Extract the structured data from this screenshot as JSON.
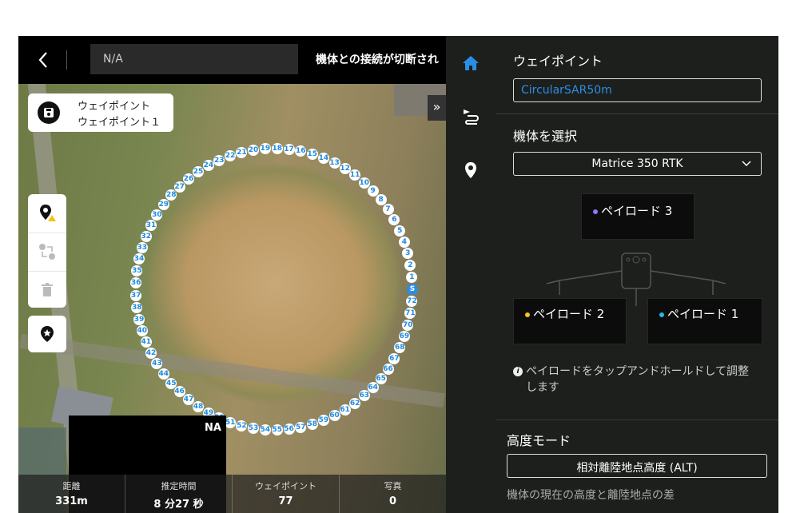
{
  "topbar": {
    "name_value": "N/A",
    "status": "機体との接続が切断され"
  },
  "save_card": {
    "line1": "ウェイポイント",
    "line2": "ウェイポイント１"
  },
  "waypoints": {
    "count": 77,
    "start_label": "S",
    "labels": [
      "1",
      "2",
      "3",
      "4",
      "5",
      "6",
      "7",
      "8",
      "9",
      "10",
      "11",
      "12",
      "13",
      "14",
      "15",
      "16",
      "17",
      "18",
      "19",
      "20",
      "21",
      "22",
      "23",
      "24",
      "25",
      "26",
      "27",
      "28",
      "29",
      "30",
      "31",
      "32",
      "33",
      "34",
      "35",
      "36",
      "37",
      "38",
      "39",
      "40",
      "41",
      "42",
      "43",
      "44",
      "45",
      "46",
      "47",
      "48",
      "49",
      "50",
      "51",
      "52",
      "53",
      "54",
      "55",
      "56",
      "57",
      "58",
      "59",
      "60",
      "61",
      "62",
      "63",
      "64",
      "65",
      "66",
      "67",
      "68",
      "69",
      "70",
      "71",
      "72"
    ],
    "accent": "#1e8be0"
  },
  "na_box": {
    "label": "NA"
  },
  "stats": [
    {
      "label": "距離",
      "value": "331m"
    },
    {
      "label": "推定時間",
      "value": "8 分27 秒"
    },
    {
      "label": "ウェイポイント",
      "value": "77"
    },
    {
      "label": "写真",
      "value": "0"
    }
  ],
  "nav": {
    "items": [
      {
        "icon": "home-icon",
        "active": true
      },
      {
        "icon": "route-icon",
        "active": false
      },
      {
        "icon": "location-pin-icon",
        "active": false
      }
    ],
    "active_color": "#2a8ee8"
  },
  "panel": {
    "waypoint_title": "ウェイポイント",
    "mission_name": "CircularSAR50m",
    "aircraft_title": "機体を選択",
    "aircraft_selected": "Matrice 350 RTK",
    "payload3": "ペイロード 3",
    "payload2": "ペイロード 2",
    "payload1": "ペイロード 1",
    "payload_hint": "ペイロードをタップアンドホールドして調整します",
    "altitude_title": "高度モード",
    "altitude_mode": "相対離陸地点高度 (ALT)",
    "altitude_desc": "機体の現在の高度と離陸地点の差"
  }
}
